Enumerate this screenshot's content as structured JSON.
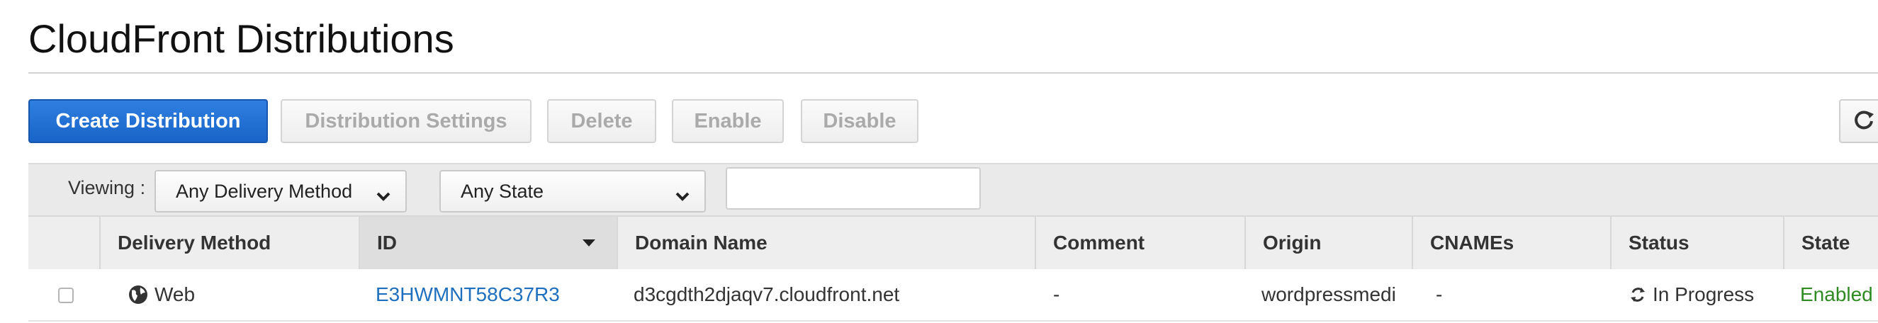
{
  "page": {
    "title": "CloudFront Distributions"
  },
  "toolbar": {
    "create_label": "Create Distribution",
    "settings_label": "Distribution Settings",
    "delete_label": "Delete",
    "enable_label": "Enable",
    "disable_label": "Disable",
    "refresh_icon": "refresh-icon"
  },
  "filters": {
    "viewing_label": "Viewing :",
    "delivery_method_value": "Any Delivery Method",
    "state_value": "Any State",
    "search_value": ""
  },
  "table": {
    "columns": [
      "Delivery Method",
      "ID",
      "Domain Name",
      "Comment",
      "Origin",
      "CNAMEs",
      "Status",
      "State"
    ],
    "rows": [
      {
        "delivery_method": "Web",
        "id": "E3HWMNT58C37R3",
        "domain_name": "d3cgdth2djaqv7.cloudfront.net",
        "comment": "-",
        "origin": "wordpressmedi",
        "cnames": "-",
        "status": "In Progress",
        "state": "Enabled"
      }
    ]
  },
  "colors": {
    "primary": "#1f6fd6",
    "link": "#1f6fbf",
    "enabled": "#2e8b22"
  }
}
